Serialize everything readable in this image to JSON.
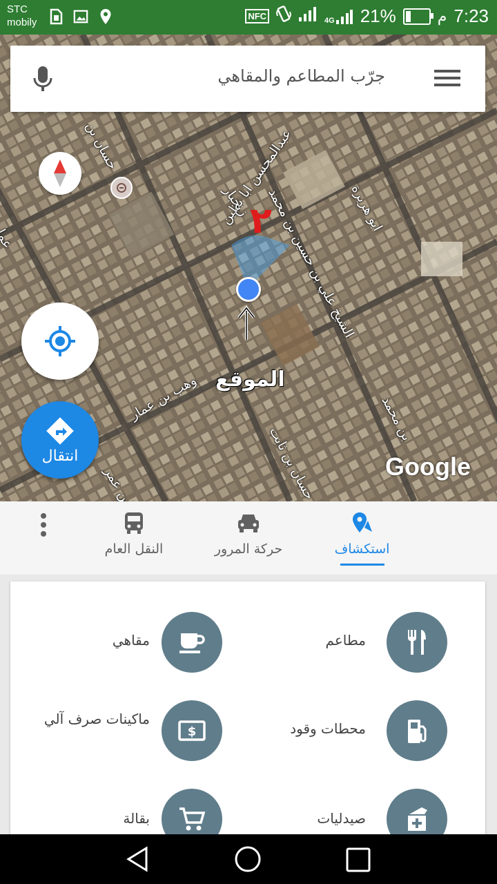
{
  "status_bar": {
    "carrier_line1": "STC",
    "carrier_line2": "mobily",
    "battery_percent": "21%",
    "battery_level": 0.21,
    "network": "4G",
    "nfc": "NFC",
    "time": "7:23",
    "ampm": "م"
  },
  "search": {
    "placeholder": "جرّب المطاعم والمقاهي"
  },
  "map": {
    "street_labels": [
      "عبدالمحسن ابا بطين",
      "زنجبار",
      "الشيخ علي بن حسين بن محمد",
      "ابو هريرة",
      "وهب بن عمار",
      "حسان بن ثابت",
      "ابن عمر",
      "بن محمد",
      "حسان بن",
      "عما"
    ],
    "annotation_location": "الموقع",
    "annotation_number": "٢",
    "google_logo": "Google",
    "go_button_label": "انتقال"
  },
  "tabs": [
    {
      "label": "استكشاف",
      "icon": "explore-pin-icon",
      "active": true
    },
    {
      "label": "حركة المرور",
      "icon": "car-icon",
      "active": false
    },
    {
      "label": "النقل العام",
      "icon": "bus-icon",
      "active": false
    }
  ],
  "categories": [
    {
      "label": "مطاعم",
      "icon": "restaurant-icon"
    },
    {
      "label": "مقاهي",
      "icon": "coffee-icon"
    },
    {
      "label": "محطات وقود",
      "icon": "gas-station-icon"
    },
    {
      "label": "ماكينات صرف آلي",
      "icon": "atm-icon"
    },
    {
      "label": "صيدليات",
      "icon": "pharmacy-icon"
    },
    {
      "label": "بقالة",
      "icon": "grocery-cart-icon"
    }
  ],
  "colors": {
    "status_bar": "#2e7d32",
    "accent": "#1e88e5",
    "category_circle": "#607d8b",
    "annotation_red": "#e01b1b"
  }
}
